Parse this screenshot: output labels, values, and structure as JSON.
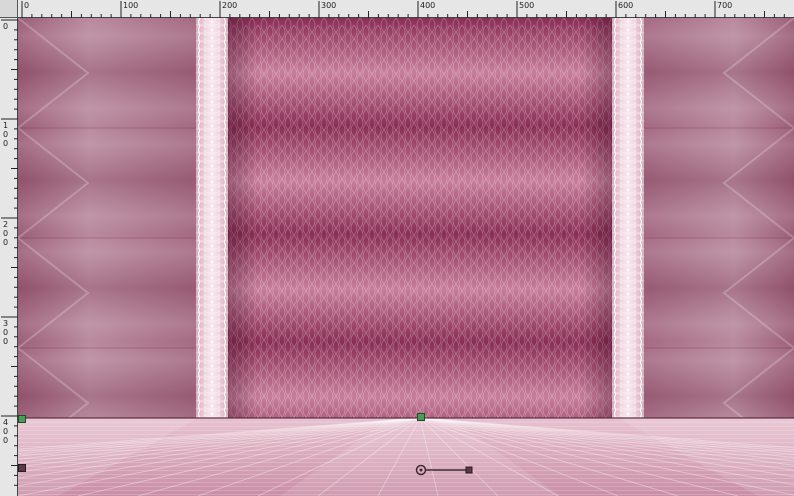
{
  "rulers": {
    "top_labels": [
      "0",
      "100",
      "200",
      "300",
      "400",
      "500",
      "600",
      "700"
    ],
    "left_labels": [
      "0",
      "1 0 0",
      "2 0 0",
      "3 0 0",
      "4 0 0"
    ]
  },
  "colors": {
    "canvas_dark": "#8a2e55",
    "canvas_light": "#c77e9b",
    "lace": "#f3dde6",
    "floor": "#d9a9bb",
    "handle": "#4a9a5a",
    "ruler_bg": "#e6e6e6"
  },
  "icons": {
    "pivot": "pivot-icon",
    "rotation_handle": "rotation-handle-icon"
  }
}
